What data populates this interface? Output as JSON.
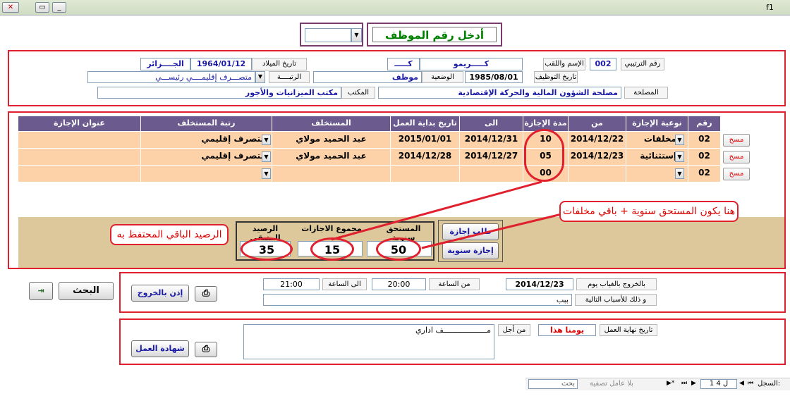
{
  "window": {
    "title": "f1"
  },
  "employee_prompt": {
    "label": "أدخل رقم الموظف",
    "value": ""
  },
  "info": {
    "serial_label": "رقم الترتيبي",
    "serial": "002",
    "name_label": "الإسم واللقب",
    "first_name": "كـــــريمو",
    "last_name": "كـــــ",
    "birth_label": "تاريخ الميلاد",
    "birth_date": "1964/01/12",
    "birth_place": "الجــــزائر",
    "hire_label": "تاريخ التوظيف",
    "hire_date": "1985/08/01",
    "status_label": "الوضعية",
    "status": "موظف",
    "rank_label": "الرتبــــة",
    "rank": "متصـــرف إقليمــــي رئيســـي",
    "office_label": "المكتب",
    "office": "مكتب الميزانيات والأجور",
    "service_label": "المصلحة",
    "service": "مصلحة الشؤون المالية والحركة الإقتصادية"
  },
  "grid": {
    "headers": [
      "رقم",
      "نوعية الإجازة",
      "من",
      "مدة الإجازة",
      "الى",
      "تاريخ بداية العمل",
      "المستخلف",
      "رتبة المستخلف",
      "عنوان الإجازة"
    ],
    "rows": [
      {
        "num": "02",
        "type": "مخلفات",
        "from": "2014/12/22",
        "days": "10",
        "to": "2014/12/31",
        "start": "2015/01/01",
        "replacement": "عبد الحميد مولاي",
        "rep_rank": "متصرف إقليمي",
        "address": "",
        "del": "مسح"
      },
      {
        "num": "02",
        "type": "إستثنائية",
        "from": "2014/12/23",
        "days": "05",
        "to": "2014/12/27",
        "start": "2014/12/28",
        "replacement": "عبد الحميد مولاي",
        "rep_rank": "متصرف إقليمي",
        "address": "",
        "del": "مسح"
      },
      {
        "num": "02",
        "type": "",
        "from": "",
        "days": "00",
        "to": "",
        "start": "",
        "replacement": "",
        "rep_rank": "",
        "address": "",
        "del": "مسح"
      }
    ]
  },
  "totals": {
    "annual_label": "المستحق سنوية",
    "annual": "50",
    "sum_label": "مجموع الاجازات",
    "sum": "15",
    "remaining_label": "الرصيد المتبقى",
    "remaining": "35"
  },
  "buttons": {
    "leave_request": "طلب إجازة",
    "annual_leave": "إجازة سنوية",
    "search": "البحث",
    "exit_permit": "إذن بالخروج",
    "work_certificate": "شهادة العمل"
  },
  "callouts": {
    "right": "هنا يكون المستحق سنوية + باقي مخلفات",
    "left": "الرصيد الباقي المحتفظ به"
  },
  "absence": {
    "day_label": "بالخروج بالغياب يوم",
    "date": "2014/12/23",
    "from_label": "من الساعة",
    "from_time": "20:00",
    "to_label": "الى الساعة",
    "to_time": "21:00",
    "reason_label": "و ذلك للأسباب التالية",
    "reason": "ببب"
  },
  "end": {
    "end_label": "تاريخ نهاية العمل",
    "end_value": "يومنا هذا",
    "for_label": "من أجل",
    "for_text": "مـــــــــــــــــــف  اداري"
  },
  "nav": {
    "record_label": "السجل:",
    "position": "1 ل 4",
    "filter": "بلا عامل تصفية",
    "search": "بحث"
  }
}
